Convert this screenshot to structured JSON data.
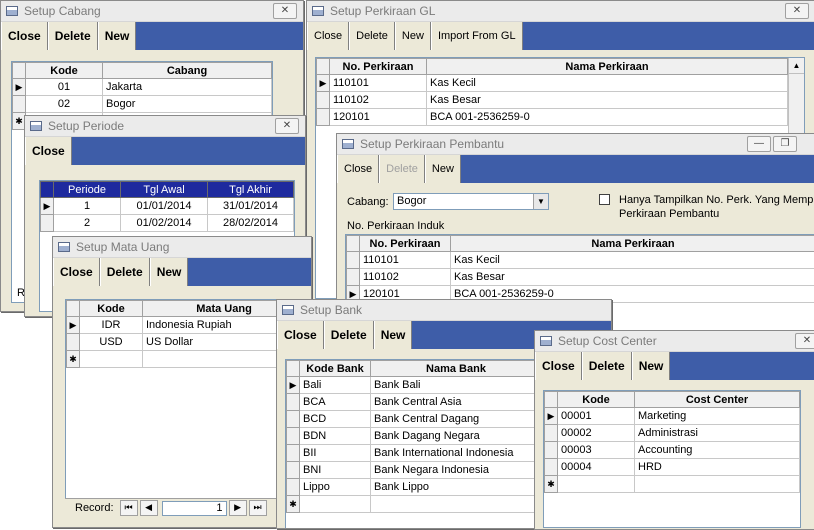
{
  "cabang": {
    "title": "Setup Cabang",
    "toolbar": [
      "Close",
      "Delete",
      "New"
    ],
    "headers": [
      "Kode",
      "Cabang"
    ],
    "rows": [
      [
        "01",
        "Jakarta"
      ],
      [
        "02",
        "Bogor"
      ]
    ]
  },
  "periode": {
    "title": "Setup Periode",
    "toolbar": [
      "Close"
    ],
    "headers": [
      "Periode",
      "Tgl Awal",
      "Tgl Akhir"
    ],
    "rows": [
      [
        "1",
        "01/01/2014",
        "31/01/2014"
      ],
      [
        "2",
        "01/02/2014",
        "28/02/2014"
      ]
    ]
  },
  "matauang": {
    "title": "Setup Mata Uang",
    "toolbar": [
      "Close",
      "Delete",
      "New"
    ],
    "headers": [
      "Kode",
      "Mata Uang"
    ],
    "rows": [
      [
        "IDR",
        "Indonesia Rupiah"
      ],
      [
        "USD",
        "US Dollar"
      ]
    ],
    "record_label": "Record:",
    "record_value": "1"
  },
  "gl": {
    "title": "Setup Perkiraan GL",
    "toolbar": [
      "Close",
      "Delete",
      "New",
      "Import From GL"
    ],
    "headers": [
      "No. Perkiraan",
      "Nama Perkiraan"
    ],
    "rows": [
      [
        "110101",
        "Kas Kecil"
      ],
      [
        "110102",
        "Kas Besar"
      ],
      [
        "120101",
        "BCA 001-2536259-0"
      ]
    ]
  },
  "pembantu": {
    "title": "Setup Perkiraan Pembantu",
    "toolbar": [
      "Close",
      "Delete",
      "New"
    ],
    "cabang_label": "Cabang:",
    "cabang_value": "Bogor",
    "checkbox_label_1": "Hanya Tampilkan No. Perk. Yang Mempu",
    "checkbox_label_2": "Perkiraan Pembantu",
    "induk_label": "No. Perkiraan Induk",
    "headers": [
      "No. Perkiraan",
      "Nama Perkiraan"
    ],
    "rows": [
      [
        "110101",
        "Kas Kecil"
      ],
      [
        "110102",
        "Kas Besar"
      ],
      [
        "120101",
        "BCA 001-2536259-0"
      ]
    ]
  },
  "bank": {
    "title": "Setup Bank",
    "toolbar": [
      "Close",
      "Delete",
      "New"
    ],
    "headers": [
      "Kode Bank",
      "Nama Bank"
    ],
    "rows": [
      [
        "Bali",
        "Bank Bali"
      ],
      [
        "BCA",
        "Bank Central Asia"
      ],
      [
        "BCD",
        "Bank Central Dagang"
      ],
      [
        "BDN",
        "Bank Dagang Negara"
      ],
      [
        "BII",
        "Bank International Indonesia"
      ],
      [
        "BNI",
        "Bank Negara Indonesia"
      ],
      [
        "Lippo",
        "Bank Lippo"
      ]
    ]
  },
  "costcenter": {
    "title": "Setup Cost Center",
    "toolbar": [
      "Close",
      "Delete",
      "New"
    ],
    "headers": [
      "Kode",
      "Cost Center"
    ],
    "rows": [
      [
        "00001",
        "Marketing"
      ],
      [
        "00002",
        "Administrasi"
      ],
      [
        "00003",
        "Accounting"
      ],
      [
        "00004",
        "HRD"
      ]
    ]
  },
  "left_edge_label": "R",
  "icons": {
    "window": "form-window-icon",
    "close": "close-icon",
    "minimize": "minimize-icon",
    "restore": "restore-icon",
    "current_row": "row-pointer-icon",
    "new_row": "new-row-asterisk-icon"
  }
}
